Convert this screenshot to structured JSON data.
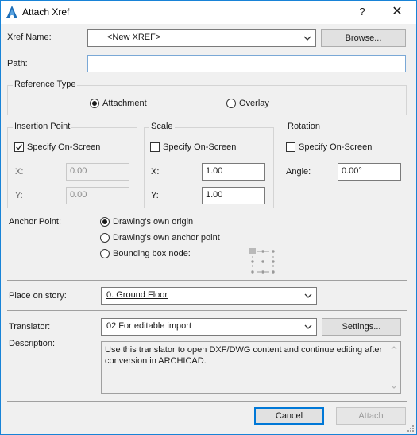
{
  "window": {
    "title": "Attach Xref",
    "help": "?",
    "close": "✕"
  },
  "xref": {
    "label": "Xref Name:",
    "value": "<New XREF>",
    "browse": "Browse..."
  },
  "path": {
    "label": "Path:",
    "value": ""
  },
  "reference_type": {
    "title": "Reference Type",
    "options": [
      {
        "label": "Attachment",
        "selected": true
      },
      {
        "label": "Overlay",
        "selected": false
      }
    ]
  },
  "insertion_point": {
    "title": "Insertion Point",
    "specify_label": "Specify On-Screen",
    "specify_checked": true,
    "x_label": "X:",
    "x_value": "0.00",
    "y_label": "Y:",
    "y_value": "0.00"
  },
  "scale": {
    "title": "Scale",
    "specify_label": "Specify On-Screen",
    "specify_checked": false,
    "x_label": "X:",
    "x_value": "1.00",
    "y_label": "Y:",
    "y_value": "1.00"
  },
  "rotation": {
    "title": "Rotation",
    "specify_label": "Specify On-Screen",
    "specify_checked": false,
    "angle_label": "Angle:",
    "angle_value": "0.00°"
  },
  "anchor_point": {
    "label": "Anchor Point:",
    "options": [
      {
        "label": "Drawing's own origin",
        "selected": true
      },
      {
        "label": "Drawing's own anchor point",
        "selected": false
      },
      {
        "label": "Bounding box node:",
        "selected": false
      }
    ]
  },
  "story": {
    "label": "Place on story:",
    "value": "0. Ground Floor"
  },
  "translator": {
    "label": "Translator:",
    "value": "02 For editable import",
    "settings": "Settings..."
  },
  "description": {
    "label": "Description:",
    "text": "Use this translator to open DXF/DWG content and continue editing after conversion in ARCHICAD."
  },
  "footer": {
    "cancel": "Cancel",
    "attach": "Attach"
  },
  "colors": {
    "accent": "#0078d7",
    "window_border": "#1883d7",
    "dialog_bg": "#f0f0f0"
  }
}
